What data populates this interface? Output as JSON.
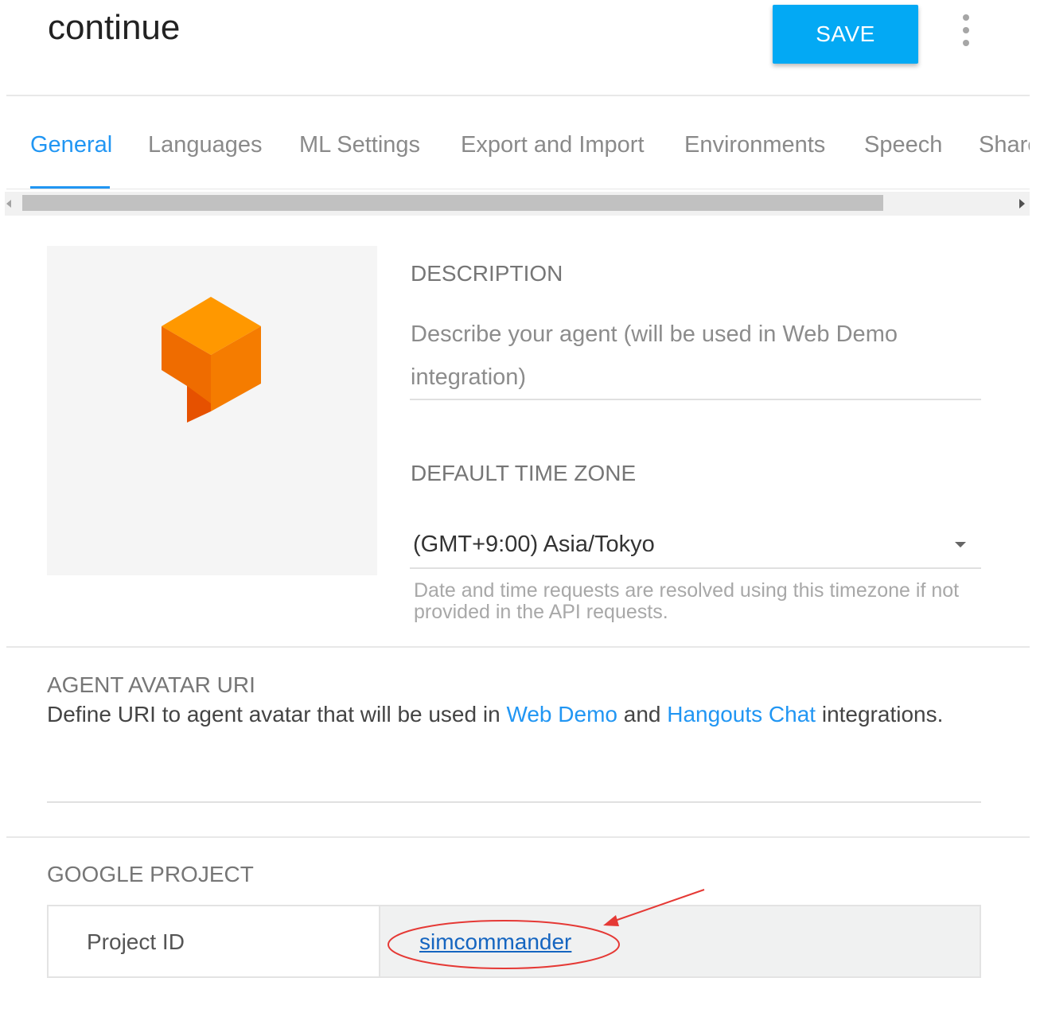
{
  "header": {
    "title": "continue",
    "save_label": "SAVE"
  },
  "tabs": [
    {
      "label": "General",
      "active": true
    },
    {
      "label": "Languages"
    },
    {
      "label": "ML Settings"
    },
    {
      "label": "Export and Import"
    },
    {
      "label": "Environments"
    },
    {
      "label": "Speech"
    },
    {
      "label": "Share"
    }
  ],
  "general": {
    "description_label": "DESCRIPTION",
    "description_placeholder": "Describe your agent (will be used in Web Demo integration)",
    "timezone_label": "DEFAULT TIME ZONE",
    "timezone_value": "(GMT+9:00) Asia/Tokyo",
    "timezone_hint": "Date and time requests are resolved using this timezone if not provided in the API requests."
  },
  "avatar_uri": {
    "label": "AGENT AVATAR URI",
    "desc_prefix": "Define URI to agent avatar that will be used in ",
    "link_web_demo": "Web Demo",
    "desc_and": " and ",
    "link_hangouts": "Hangouts Chat",
    "desc_suffix": " integrations.",
    "value": ""
  },
  "google_project": {
    "label": "GOOGLE PROJECT",
    "project_id_label": "Project ID",
    "project_id_value": "simcommander"
  },
  "colors": {
    "accent": "#2196f3",
    "save_button": "#03a9f4",
    "logo_orange_top": "#ff9800",
    "logo_orange_side": "#ef6c00",
    "annotation_red": "#e53935"
  }
}
